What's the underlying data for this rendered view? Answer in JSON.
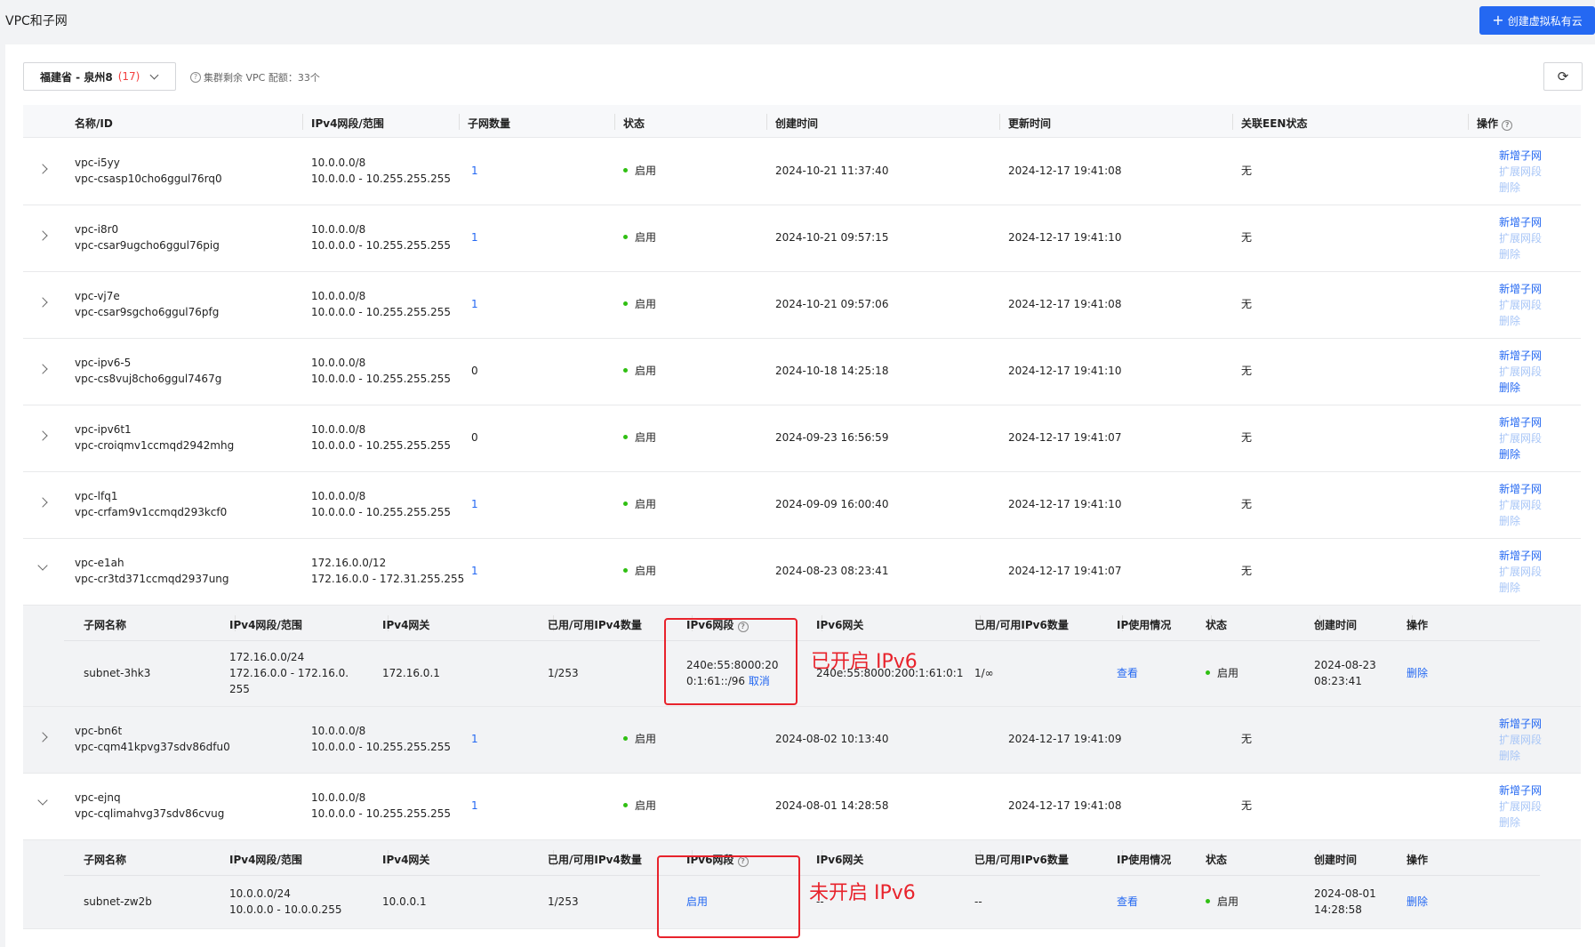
{
  "page": {
    "title": "VPC和子网"
  },
  "create_button": {
    "label": "创建虚拟私有云"
  },
  "region": {
    "label": "福建省 - 泉州8",
    "count": "(17)"
  },
  "quota": {
    "text": "集群剩余 VPC 配额：33个"
  },
  "columns": [
    "名称/ID",
    "IPv4网段/范围",
    "子网数量",
    "状态",
    "创建时间",
    "更新时间",
    "关联EEN状态",
    "操作"
  ],
  "ops_labels": {
    "add_subnet": "新增子网",
    "expand": "扩展网段",
    "delete": "删除"
  },
  "rows": [
    {
      "name": "vpc-i5yy",
      "id": "vpc-csasp10cho6ggul76rq0",
      "cidr": "10.0.0.0/8",
      "range": "10.0.0.0 - 10.255.255.255",
      "subnets": "1",
      "status": "启用",
      "created": "2024-10-21 11:37:40",
      "updated": "2024-12-17 19:41:08",
      "een": "无"
    },
    {
      "name": "vpc-i8r0",
      "id": "vpc-csar9ugcho6ggul76pig",
      "cidr": "10.0.0.0/8",
      "range": "10.0.0.0 - 10.255.255.255",
      "subnets": "1",
      "status": "启用",
      "created": "2024-10-21 09:57:15",
      "updated": "2024-12-17 19:41:10",
      "een": "无"
    },
    {
      "name": "vpc-vj7e",
      "id": "vpc-csar9sgcho6ggul76pfg",
      "cidr": "10.0.0.0/8",
      "range": "10.0.0.0 - 10.255.255.255",
      "subnets": "1",
      "status": "启用",
      "created": "2024-10-21 09:57:06",
      "updated": "2024-12-17 19:41:08",
      "een": "无"
    },
    {
      "name": "vpc-ipv6-5",
      "id": "vpc-cs8vuj8cho6ggul7467g",
      "cidr": "10.0.0.0/8",
      "range": "10.0.0.0 - 10.255.255.255",
      "subnets": "0",
      "status": "启用",
      "created": "2024-10-18 14:25:18",
      "updated": "2024-12-17 19:41:10",
      "een": "无"
    },
    {
      "name": "vpc-ipv6t1",
      "id": "vpc-croiqmv1ccmqd2942mhg",
      "cidr": "10.0.0.0/8",
      "range": "10.0.0.0 - 10.255.255.255",
      "subnets": "0",
      "status": "启用",
      "created": "2024-09-23 16:56:59",
      "updated": "2024-12-17 19:41:07",
      "een": "无"
    },
    {
      "name": "vpc-lfq1",
      "id": "vpc-crfam9v1ccmqd293kcf0",
      "cidr": "10.0.0.0/8",
      "range": "10.0.0.0 - 10.255.255.255",
      "subnets": "1",
      "status": "启用",
      "created": "2024-09-09 16:00:40",
      "updated": "2024-12-17 19:41:10",
      "een": "无"
    },
    {
      "name": "vpc-e1ah",
      "id": "vpc-cr3td371ccmqd2937ung",
      "cidr": "172.16.0.0/12",
      "range": "172.16.0.0 - 172.31.255.255",
      "subnets": "1",
      "status": "启用",
      "created": "2024-08-23 08:23:41",
      "updated": "2024-12-17 19:41:07",
      "een": "无"
    },
    {
      "name": "vpc-bn6t",
      "id": "vpc-cqm41kpvg37sdv86dfu0",
      "cidr": "10.0.0.0/8",
      "range": "10.0.0.0 - 10.255.255.255",
      "subnets": "1",
      "status": "启用",
      "created": "2024-08-02 10:13:40",
      "updated": "2024-12-17 19:41:09",
      "een": "无"
    },
    {
      "name": "vpc-ejnq",
      "id": "vpc-cqlimahvg37sdv86cvug",
      "cidr": "10.0.0.0/8",
      "range": "10.0.0.0 - 10.255.255.255",
      "subnets": "1",
      "status": "启用",
      "created": "2024-08-01 14:28:58",
      "updated": "2024-12-17 19:41:08",
      "een": "无"
    }
  ],
  "sub_columns": [
    "子网名称",
    "IPv4网段/范围",
    "IPv4网关",
    "已用/可用IPv4数量",
    "IPv6网段",
    "IPv6网关",
    "已用/可用IPv6数量",
    "IP使用情况",
    "状态",
    "创建时间",
    "操作"
  ],
  "subnets": [
    {
      "name": "subnet-3hk3",
      "cidr": "172.16.0.0/24",
      "range": "172.16.0.0 - 172.16.0.255",
      "gateway": "172.16.0.1",
      "ipv4_count": "1/253",
      "ipv6_cidr": "240e:55:8000:200:1:61::/96",
      "ipv6_action": "取消",
      "ipv6_gateway": "240e:55:8000:200:1:61:0:1",
      "ipv6_count": "1/∞",
      "usage": "查看",
      "status": "启用",
      "created_date": "2024-08-23",
      "created_time": "08:23:41",
      "op": "删除"
    },
    {
      "name": "subnet-zw2b",
      "cidr": "10.0.0.0/24",
      "range": "10.0.0.0 - 10.0.0.255",
      "gateway": "10.0.0.1",
      "ipv4_count": "1/253",
      "ipv6_action": "启用",
      "ipv6_gateway": "--",
      "ipv6_count": "--",
      "usage": "查看",
      "status": "启用",
      "created_date": "2024-08-01",
      "created_time": "14:28:58",
      "op": "删除"
    }
  ],
  "annotations": {
    "enabled": "已开启 IPv6",
    "disabled": "未开启 IPv6"
  }
}
